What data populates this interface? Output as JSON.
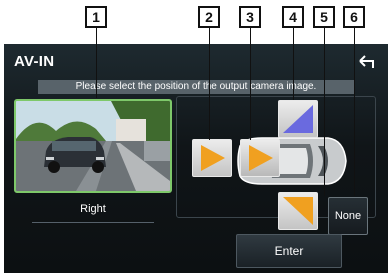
{
  "screen": {
    "title": "AV-IN",
    "back_icon": "back-arrow-icon",
    "instruction": "Please select the position of the output camera image."
  },
  "preview": {
    "selected_label": "Right"
  },
  "positions": {
    "none_label": "None",
    "arrow_color_orange": "#f0a020",
    "arrow_color_purple": "#6a6adf"
  },
  "footer": {
    "enter_label": "Enter"
  },
  "callouts": [
    "1",
    "2",
    "3",
    "4",
    "5",
    "6"
  ]
}
